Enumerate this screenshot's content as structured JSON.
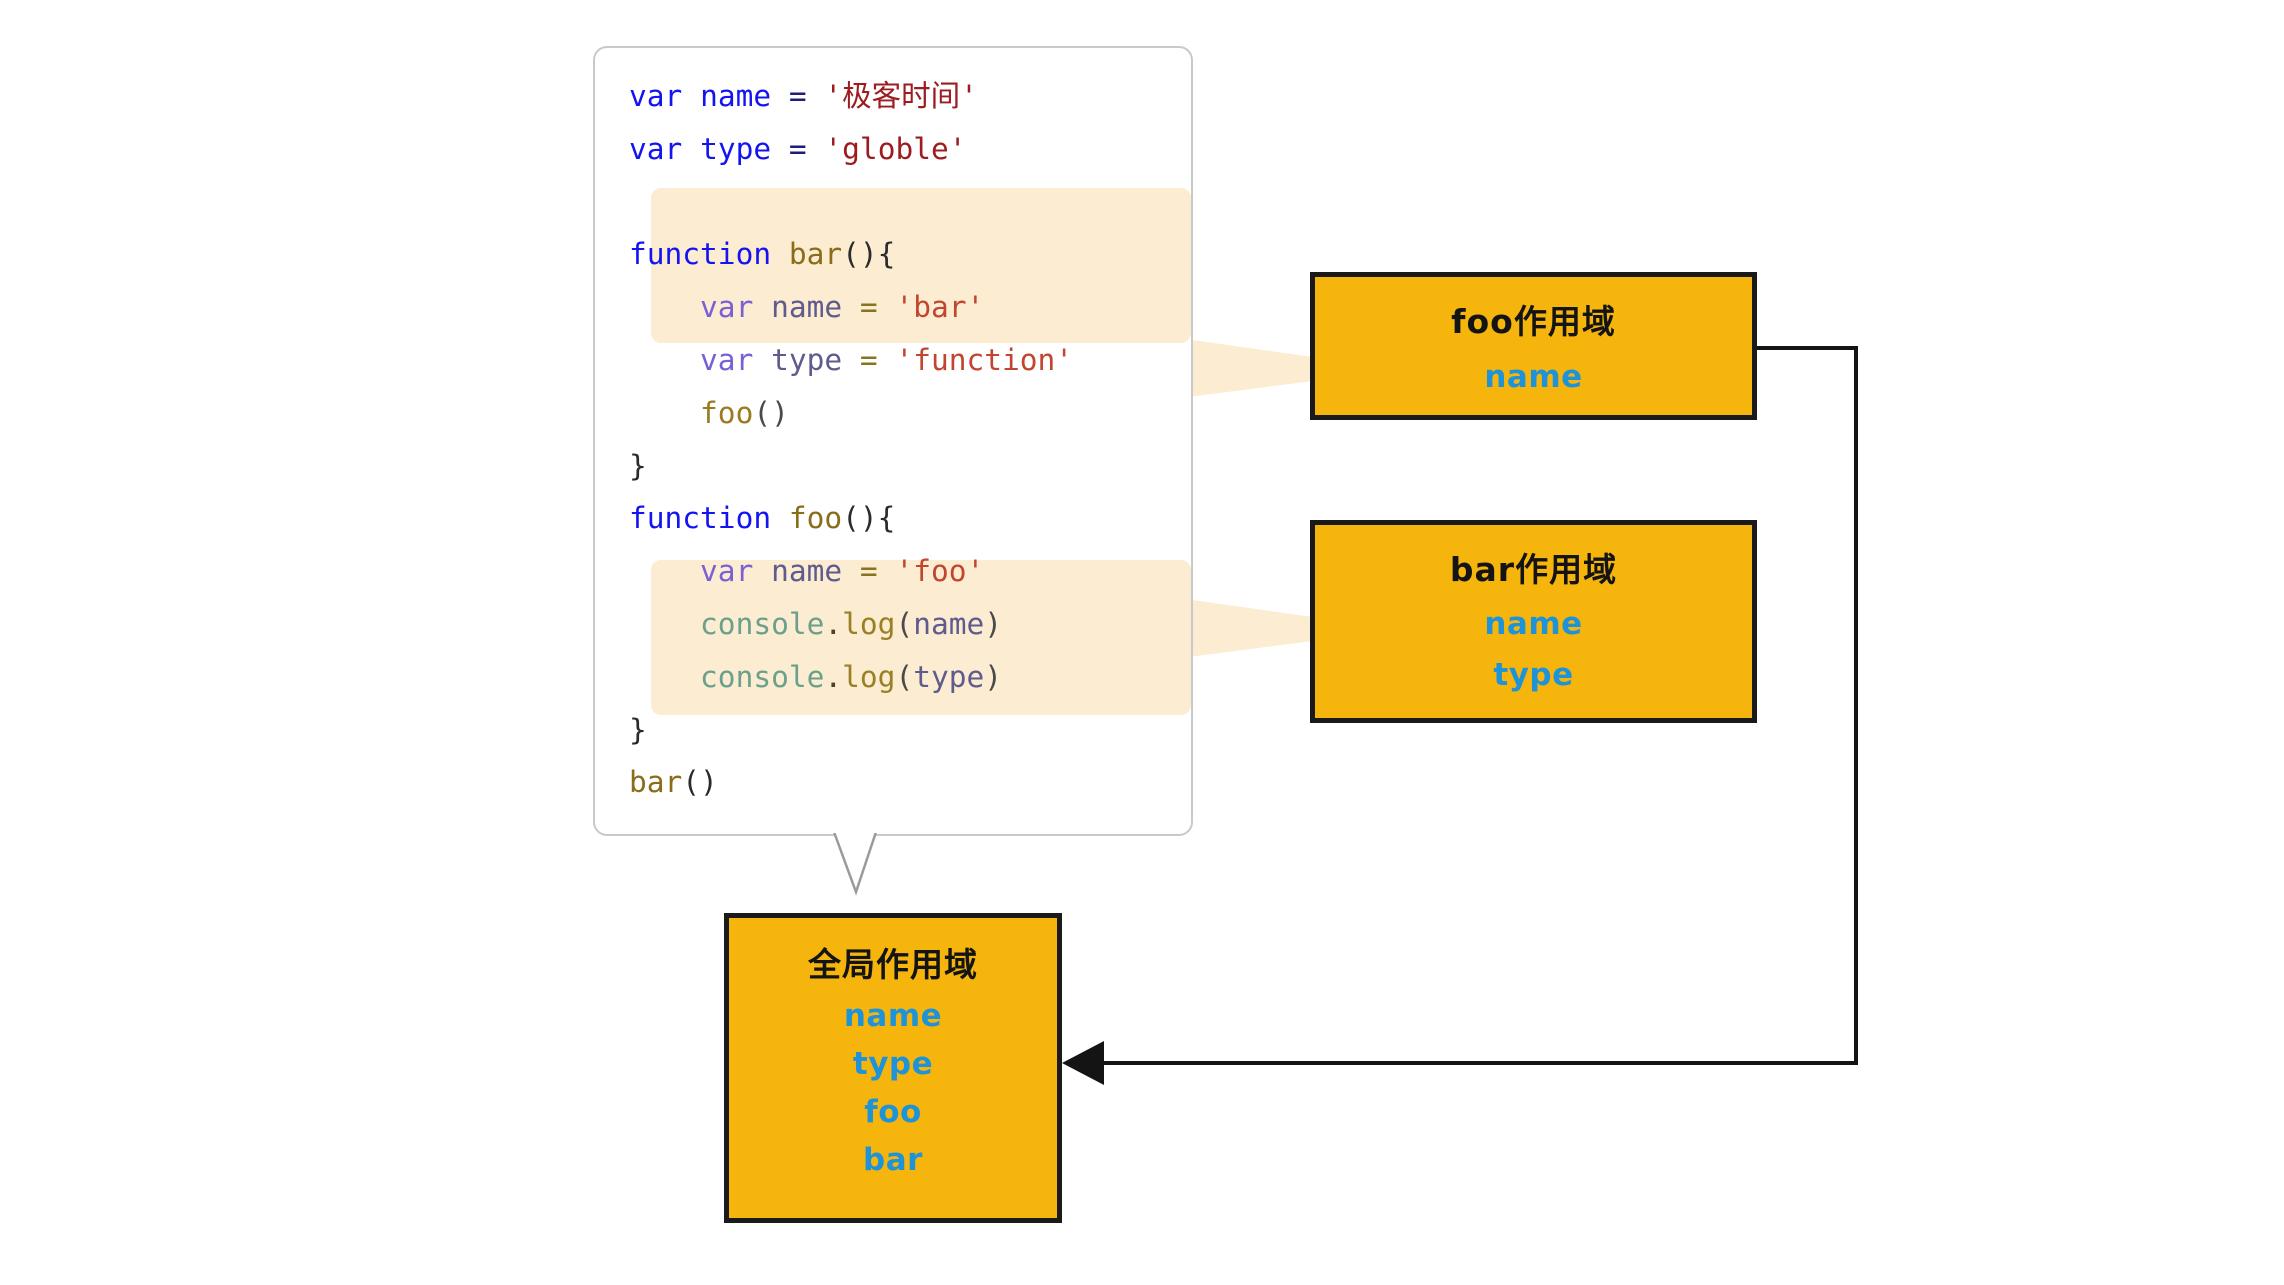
{
  "diagram": {
    "title": "JavaScript scope chain diagram",
    "colors": {
      "scope_box_fill": "#f5b50d",
      "scope_box_border": "#1a1a1a",
      "scope_var_text": "#1f93d8",
      "highlight_fill": "#fbecd2",
      "code_panel_border": "#c9c9c9",
      "keyword_global": "#1414f0",
      "string_global": "#9c1c20",
      "keyword_highlight": "#7a5fd6",
      "string_highlight": "#c1452f",
      "console_object": "#6aa08c",
      "function_name": "#8a6d1a"
    }
  },
  "code_panel": {
    "lines": [
      {
        "id": "line-1",
        "highlighted": false,
        "tokens": [
          {
            "t": "var",
            "c": "tok-kw"
          },
          {
            "t": " ",
            "c": "tok-punct"
          },
          {
            "t": "name",
            "c": "tok-var-g"
          },
          {
            "t": " ",
            "c": "tok-punct"
          },
          {
            "t": "=",
            "c": "tok-eq-g"
          },
          {
            "t": " ",
            "c": "tok-punct"
          },
          {
            "t": "'极客时间'",
            "c": "tok-str-g"
          }
        ]
      },
      {
        "id": "line-2",
        "highlighted": false,
        "tokens": [
          {
            "t": "var",
            "c": "tok-kw"
          },
          {
            "t": " ",
            "c": "tok-punct"
          },
          {
            "t": "type",
            "c": "tok-var-g"
          },
          {
            "t": " ",
            "c": "tok-punct"
          },
          {
            "t": "=",
            "c": "tok-eq-g"
          },
          {
            "t": " ",
            "c": "tok-punct"
          },
          {
            "t": "'globle'",
            "c": "tok-str-g"
          }
        ]
      },
      {
        "id": "line-3",
        "highlighted": false,
        "tokens": [
          {
            "t": " ",
            "c": "tok-punct"
          }
        ]
      },
      {
        "id": "line-4",
        "highlighted": false,
        "tokens": [
          {
            "t": "function",
            "c": "tok-kw"
          },
          {
            "t": " ",
            "c": "tok-punct"
          },
          {
            "t": "bar",
            "c": "tok-fn"
          },
          {
            "t": "(){",
            "c": "tok-punct"
          }
        ]
      },
      {
        "id": "line-5",
        "highlighted": true,
        "tokens": [
          {
            "t": "    ",
            "c": "tok-punct"
          },
          {
            "t": "var",
            "c": "tok-kw-h"
          },
          {
            "t": " ",
            "c": "tok-punct"
          },
          {
            "t": "name",
            "c": "tok-id-h"
          },
          {
            "t": " ",
            "c": "tok-punct"
          },
          {
            "t": "=",
            "c": "tok-eq-h"
          },
          {
            "t": " ",
            "c": "tok-punct"
          },
          {
            "t": "'bar'",
            "c": "tok-str-h"
          }
        ]
      },
      {
        "id": "line-6",
        "highlighted": true,
        "tokens": [
          {
            "t": "    ",
            "c": "tok-punct"
          },
          {
            "t": "var",
            "c": "tok-kw-h"
          },
          {
            "t": " ",
            "c": "tok-punct"
          },
          {
            "t": "type",
            "c": "tok-id-h"
          },
          {
            "t": " ",
            "c": "tok-punct"
          },
          {
            "t": "=",
            "c": "tok-eq-h"
          },
          {
            "t": " ",
            "c": "tok-punct"
          },
          {
            "t": "'function'",
            "c": "tok-str-h"
          }
        ]
      },
      {
        "id": "line-7",
        "highlighted": true,
        "tokens": [
          {
            "t": "    ",
            "c": "tok-punct"
          },
          {
            "t": "foo",
            "c": "tok-fn-h"
          },
          {
            "t": "()",
            "c": "tok-paren-h"
          }
        ]
      },
      {
        "id": "line-8",
        "highlighted": false,
        "tokens": [
          {
            "t": "}",
            "c": "tok-punct"
          }
        ]
      },
      {
        "id": "line-9",
        "highlighted": false,
        "tokens": [
          {
            "t": "function",
            "c": "tok-kw"
          },
          {
            "t": " ",
            "c": "tok-punct"
          },
          {
            "t": "foo",
            "c": "tok-fn"
          },
          {
            "t": "(){",
            "c": "tok-punct"
          }
        ]
      },
      {
        "id": "line-10",
        "highlighted": true,
        "tokens": [
          {
            "t": "    ",
            "c": "tok-punct"
          },
          {
            "t": "var",
            "c": "tok-kw-h"
          },
          {
            "t": " ",
            "c": "tok-punct"
          },
          {
            "t": "name",
            "c": "tok-id-h"
          },
          {
            "t": " ",
            "c": "tok-punct"
          },
          {
            "t": "=",
            "c": "tok-eq-h"
          },
          {
            "t": " ",
            "c": "tok-punct"
          },
          {
            "t": "'foo'",
            "c": "tok-str-h"
          }
        ]
      },
      {
        "id": "line-11",
        "highlighted": true,
        "tokens": [
          {
            "t": "    ",
            "c": "tok-punct"
          },
          {
            "t": "console",
            "c": "tok-obj-h"
          },
          {
            "t": ".",
            "c": "tok-dot-h"
          },
          {
            "t": "log",
            "c": "tok-prop-h"
          },
          {
            "t": "(",
            "c": "tok-paren-h"
          },
          {
            "t": "name",
            "c": "tok-id-h"
          },
          {
            "t": ")",
            "c": "tok-paren-h"
          }
        ]
      },
      {
        "id": "line-12",
        "highlighted": true,
        "tokens": [
          {
            "t": "    ",
            "c": "tok-punct"
          },
          {
            "t": "console",
            "c": "tok-obj-h"
          },
          {
            "t": ".",
            "c": "tok-dot-h"
          },
          {
            "t": "log",
            "c": "tok-prop-h"
          },
          {
            "t": "(",
            "c": "tok-paren-h"
          },
          {
            "t": "type",
            "c": "tok-id-h"
          },
          {
            "t": ")",
            "c": "tok-paren-h"
          }
        ]
      },
      {
        "id": "line-13",
        "highlighted": false,
        "tokens": [
          {
            "t": "}",
            "c": "tok-punct"
          }
        ]
      },
      {
        "id": "line-14",
        "highlighted": false,
        "tokens": [
          {
            "t": "bar",
            "c": "tok-fn"
          },
          {
            "t": "()",
            "c": "tok-punct"
          }
        ]
      }
    ]
  },
  "scopes": {
    "foo": {
      "title": "foo作用域",
      "variables": [
        "name"
      ]
    },
    "bar": {
      "title": "bar作用域",
      "variables": [
        "name",
        "type"
      ]
    },
    "global": {
      "title": "全局作用域",
      "variables": [
        "name",
        "type",
        "foo",
        "bar"
      ]
    }
  }
}
